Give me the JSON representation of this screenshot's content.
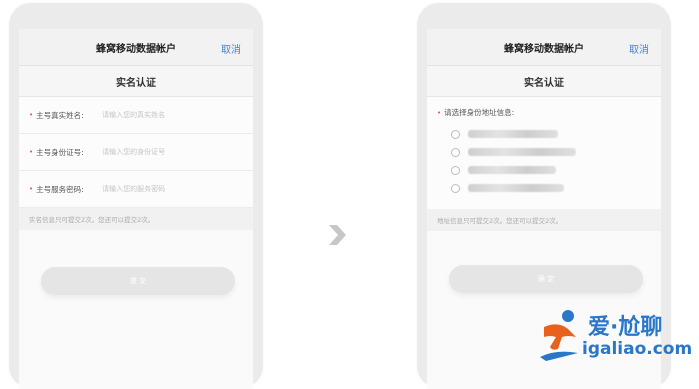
{
  "left_screen": {
    "nav_title": "蜂窝移动数据帐户",
    "cancel": "取消",
    "subtitle": "实名认证",
    "fields": [
      {
        "label": "主号真实姓名:",
        "placeholder": "请输入您的真实姓名"
      },
      {
        "label": "主号身份证号:",
        "placeholder": "请输入您的身份证号"
      },
      {
        "label": "主号服务密码:",
        "placeholder": "请输入您的服务密码"
      }
    ],
    "note": "实名信息只可提交2次。您还可以提交2次。",
    "submit": "提 交"
  },
  "right_screen": {
    "nav_title": "蜂窝移动数据帐户",
    "cancel": "取消",
    "subtitle": "实名认证",
    "address_prompt": "请选择身份地址信息:",
    "note": "地址信息只可提交2次。您还可以提交2次。",
    "submit": "确 定"
  },
  "logo": {
    "text_cn": "爱·尬聊",
    "url": "igaliao.com",
    "brand_color": "#2a77c9",
    "accent_color": "#e8621e"
  },
  "colors": {
    "link": "#3a86d6",
    "required_star": "#e25b4b"
  },
  "icons": {
    "arrow": "chevron-right-icon",
    "radio": "radio-icon"
  }
}
